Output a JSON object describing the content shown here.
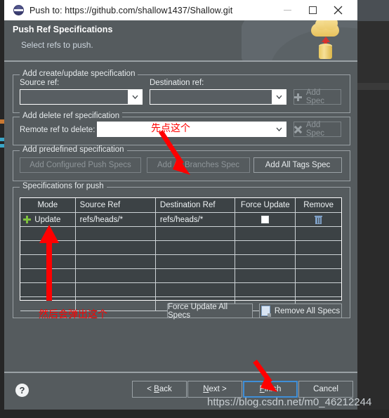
{
  "window": {
    "title": "Push to: https://github.com/shallow1437/Shallow.git",
    "icon": "eclipse-icon",
    "minimize_label": "minimize-icon",
    "maximize_label": "maximize-icon",
    "close_label": "close-icon"
  },
  "banner": {
    "heading": "Push Ref Specifications",
    "subtitle": "Select refs to push.",
    "icon": "cloud-upload-icon"
  },
  "create_update_group": {
    "title": "Add create/update specification",
    "source_label": "Source ref:",
    "source_value": "",
    "destination_label": "Destination ref:",
    "destination_value": "",
    "add_spec_label": "Add Spec"
  },
  "delete_group": {
    "title": "Add delete ref specification",
    "remote_label": "Remote ref to delete:",
    "remote_value": "",
    "add_spec_label": "Add Spec"
  },
  "predefined_group": {
    "title": "Add predefined specification",
    "add_configured_label": "Add Configured Push Specs",
    "add_all_branches_label": "Add All Branches Spec",
    "add_all_tags_label": "Add All Tags Spec"
  },
  "specs_group": {
    "title": "Specifications for push",
    "columns": [
      "Mode",
      "Source Ref",
      "Destination Ref",
      "Force Update",
      "Remove"
    ],
    "rows": [
      {
        "mode": "Update",
        "mode_icon": "green-plus-icon",
        "source_ref": "refs/heads/*",
        "destination_ref": "refs/heads/*",
        "force_update": false,
        "remove_icon": "trash-icon"
      }
    ],
    "empty_row_count": 6,
    "force_update_all_label": "Force Update All Specs",
    "remove_all_label": "Remove All Specs",
    "remove_all_icon": "remove-all-icon"
  },
  "footer": {
    "help_icon": "help-icon",
    "back_label_pre": "< ",
    "back_label_key": "B",
    "back_label_post": "ack",
    "next_label_pre": "",
    "next_label_key": "N",
    "next_label_post": "ext >",
    "finish_label_pre": "",
    "finish_label_key": "F",
    "finish_label_post": "inish",
    "cancel_label": "Cancel"
  },
  "annotations": {
    "first_note": "先点这个",
    "second_note": "然后会弹出这个",
    "arrow_color": "#ff0000"
  },
  "watermark": "https://blog.csdn.net/m0_46212244",
  "colors": {
    "dialog_bg": "#555b5e",
    "titlebar_bg": "#ffffff",
    "table_bg": "#3c4245",
    "focus_blue": "#3f8fd8",
    "accent_green": "#7ec13f",
    "annotation_red": "#ff0000"
  }
}
